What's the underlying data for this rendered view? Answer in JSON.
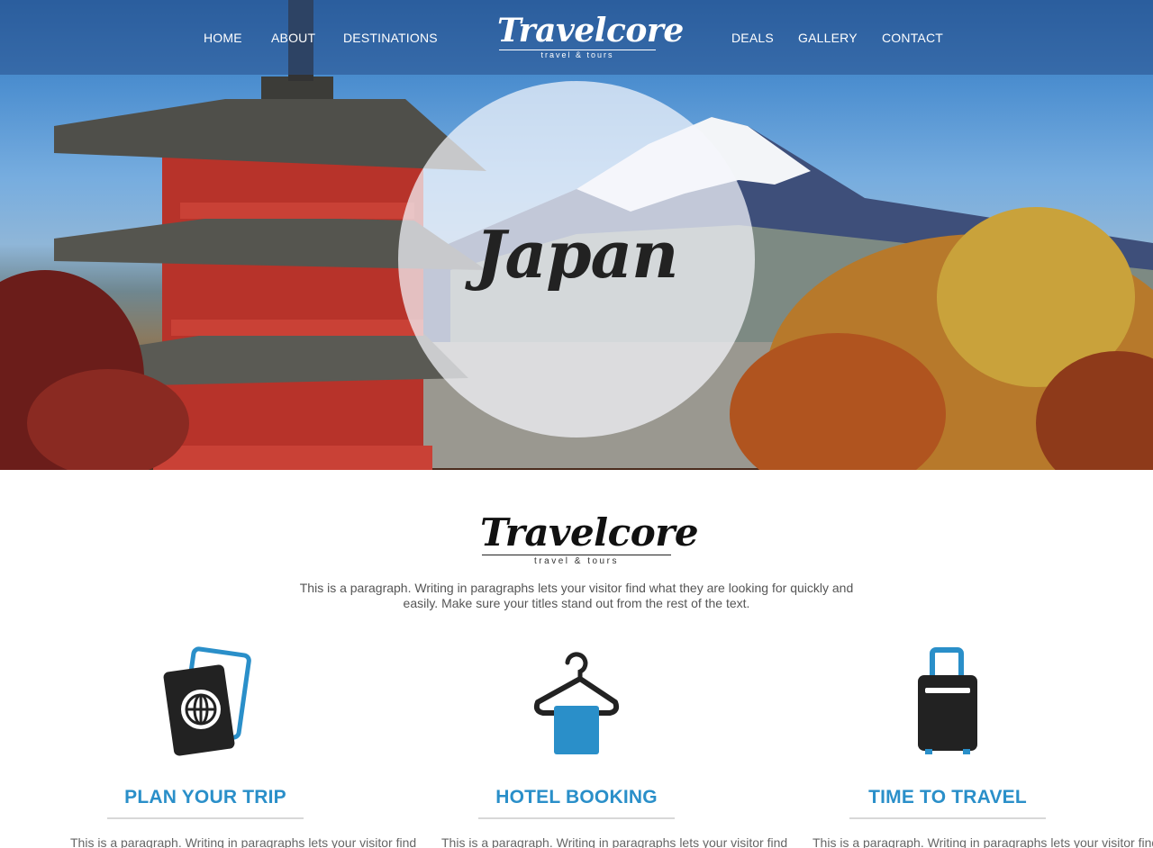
{
  "colors": {
    "accent": "#2a8fc9",
    "nav_overlay": "#2f5f9c",
    "text": "#555555"
  },
  "nav": {
    "left_links": [
      "HOME",
      "ABOUT",
      "DESTINATIONS"
    ],
    "right_links": [
      "DEALS",
      "GALLERY",
      "CONTACT"
    ],
    "logo": {
      "name": "Travelcore",
      "tagline": "travel & tours"
    }
  },
  "hero": {
    "title": "Japan"
  },
  "brand": {
    "logo": {
      "name": "Travelcore",
      "tagline": "travel & tours"
    },
    "paragraph": "This is a paragraph. Writing in paragraphs lets your visitor find what they are looking for quickly and easily. Make sure your titles stand out from the rest of the text."
  },
  "features": [
    {
      "icon": "passport-icon",
      "title": "PLAN YOUR TRIP",
      "text": "This is a paragraph. Writing in paragraphs lets your visitor find"
    },
    {
      "icon": "hanger-icon",
      "title": "HOTEL BOOKING",
      "text": "This is a paragraph. Writing in paragraphs lets your visitor find"
    },
    {
      "icon": "suitcase-icon",
      "title": "TIME TO TRAVEL",
      "text": "This is a paragraph. Writing in paragraphs lets your visitor find"
    }
  ]
}
